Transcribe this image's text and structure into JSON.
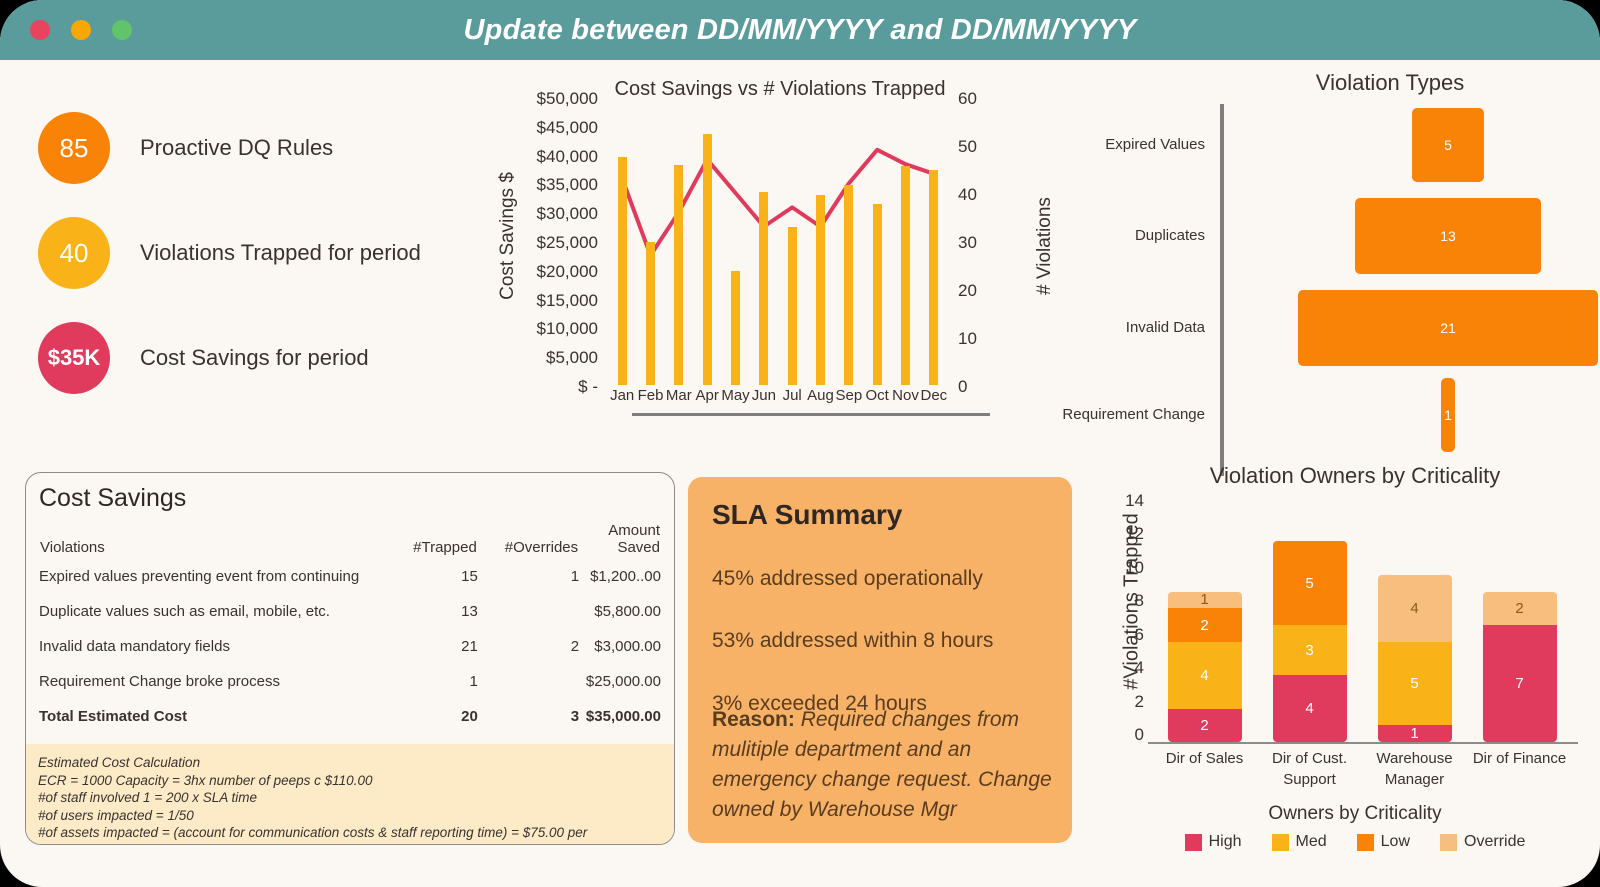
{
  "window": {
    "title": "Update between DD/MM/YYYY and DD/MM/YYYY",
    "titlebar_color": "#5A9C9C",
    "background_color": "#FBF7F2",
    "dots": [
      {
        "name": "close",
        "color": "#E8445E"
      },
      {
        "name": "minimize",
        "color": "#F7A800"
      },
      {
        "name": "maximize",
        "color": "#61C46A"
      }
    ]
  },
  "kpis": [
    {
      "value": "85",
      "label": "Proactive DQ Rules",
      "color": "#F98307"
    },
    {
      "value": "40",
      "label": "Violations Trapped for period",
      "color": "#F9B218"
    },
    {
      "value": "$35K",
      "label": "Cost Savings for period",
      "color": "#E03A5C"
    }
  ],
  "chart_data": [
    {
      "type": "bar",
      "id": "cost-savings-vs-violations",
      "title": "Cost Savings vs # Violations Trapped",
      "xlabel": "",
      "ylabel": "Cost Savings $",
      "y2label": "# Violations",
      "categories": [
        "Jan",
        "Feb",
        "Mar",
        "Apr",
        "May",
        "Jun",
        "Jul",
        "Aug",
        "Sep",
        "Oct",
        "Nov",
        "Dec"
      ],
      "ytick_labels": [
        "$50,000",
        "$45,000",
        "$40,000",
        "$35,000",
        "$30,000",
        "$25,000",
        "$20,000",
        "$15,000",
        "$10,000",
        "$5,000",
        "$ -"
      ],
      "ylim": [
        0,
        50000
      ],
      "y2tick_labels": [
        "60",
        "50",
        "40",
        "30",
        "20",
        "10",
        "0"
      ],
      "y2lim": [
        0,
        60
      ],
      "grid": false,
      "series": [
        {
          "name": "Cost Savings $",
          "kind": "bar",
          "color": "#F9B218",
          "axis": "left",
          "values": [
            39500,
            24800,
            38200,
            43500,
            19800,
            33500,
            27500,
            33000,
            34800,
            31500,
            38000,
            37300
          ]
        },
        {
          "name": "# Violations",
          "kind": "line",
          "color": "#E03A5C",
          "axis": "right",
          "values": [
            43,
            27,
            36,
            47,
            40,
            33,
            37,
            33,
            42,
            49,
            46,
            44
          ]
        }
      ]
    },
    {
      "type": "bar",
      "id": "violation-types",
      "orientation": "horizontal",
      "title": "Violation Types",
      "categories": [
        "Expired Values",
        "Duplicates",
        "Invalid Data",
        "Requirement Change"
      ],
      "values": [
        5,
        13,
        21,
        1
      ],
      "bar_color": "#F98307",
      "xlabel": "",
      "ylabel": ""
    },
    {
      "type": "bar",
      "id": "violation-owners-by-criticality",
      "stacked": true,
      "title": "Violation Owners by Criticality",
      "caption": "Owners by Criticality",
      "ylabel": "#Violations Trapped",
      "ytick_labels": [
        "14",
        "12",
        "10",
        "8",
        "6",
        "4",
        "2",
        "0"
      ],
      "ylim": [
        0,
        14
      ],
      "categories": [
        "Dir of Sales",
        "Dir of Cust. Support",
        "Warehouse Manager",
        "Dir of Finance"
      ],
      "category_lines": [
        [
          "Dir of Sales"
        ],
        [
          "Dir of Cust.",
          "Support"
        ],
        [
          "Warehouse",
          "Manager"
        ],
        [
          "Dir of Finance"
        ]
      ],
      "legend_position": "bottom",
      "series": [
        {
          "name": "High",
          "color": "#E03A5C",
          "values": [
            2,
            4,
            1,
            7
          ]
        },
        {
          "name": "Med",
          "color": "#F9B218",
          "values": [
            4,
            3,
            5,
            0
          ]
        },
        {
          "name": "Low",
          "color": "#F98307",
          "values": [
            2,
            5,
            0,
            0
          ]
        },
        {
          "name": "Override",
          "color": "#F8BE7E",
          "values": [
            1,
            0,
            4,
            2
          ]
        }
      ]
    }
  ],
  "cost_savings_card": {
    "title": "Cost Savings",
    "headers": [
      "Violations",
      "#Trapped",
      "#Overrides",
      "Amount Saved"
    ],
    "header_amount_line1": "Amount",
    "header_amount_line2": "Saved",
    "rows": [
      {
        "violation": "Expired values preventing event from continuing",
        "trapped": "15",
        "overrides": "1",
        "saved": "$1,200..00"
      },
      {
        "violation": "Duplicate values such as email, mobile, etc.",
        "trapped": "13",
        "overrides": "",
        "saved": "$5,800.00"
      },
      {
        "violation": "Invalid data mandatory fields",
        "trapped": "21",
        "overrides": "2",
        "saved": "$3,000.00"
      },
      {
        "violation": "Requirement Change broke process",
        "trapped": "1",
        "overrides": "",
        "saved": "$25,000.00"
      }
    ],
    "total": {
      "violation": "Total Estimated Cost",
      "trapped": "20",
      "overrides": "3",
      "saved": "$35,000.00"
    },
    "note": {
      "heading": "Estimated Cost Calculation",
      "lines": [
        "ECR = 1000     Capacity = 3hx number of peeps c $110.00",
        "#of staff involved 1 = 200 x SLA time",
        "#of users impacted = 1/50",
        "#of assets impacted = (account for communication costs & staff reporting time) = $75.00 per"
      ]
    }
  },
  "sla_summary": {
    "title": "SLA Summary",
    "lines": [
      "45% addressed operationally",
      "53% addressed within 8 hours",
      "3% exceeded 24 hours"
    ],
    "reason_label": "Reason:",
    "reason_text": "Required changes from mulitiple department and an emergency change request. Change owned by Warehouse Mgr",
    "background_color": "#F7B267"
  }
}
